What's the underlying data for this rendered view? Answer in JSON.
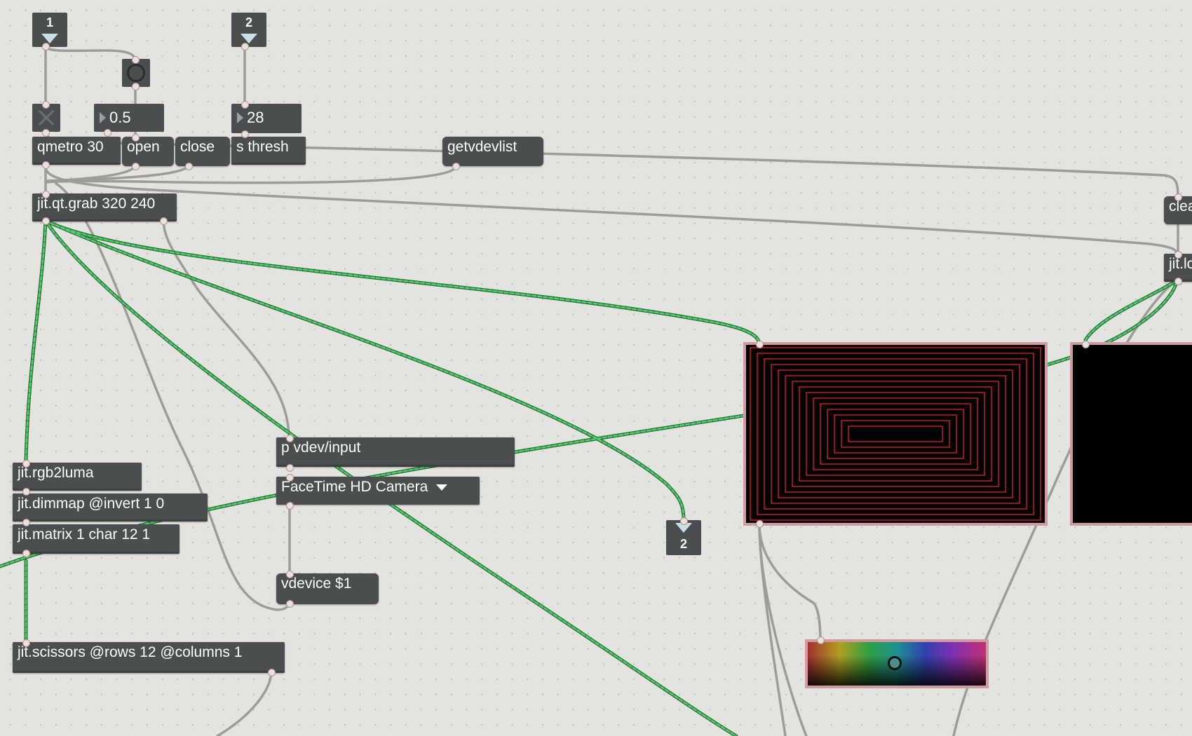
{
  "patcher": {
    "flags": [
      {
        "id": "flag-1",
        "label": "1"
      },
      {
        "id": "flag-2",
        "label": "2"
      },
      {
        "id": "flag-out-2",
        "label": "2"
      }
    ],
    "numbers": {
      "float_value": "0.5",
      "int_value": "28"
    },
    "objects": {
      "qmetro": "qmetro 30",
      "open": "open",
      "close": "close",
      "s_thresh": "s thresh",
      "getvdevlist": "getvdevlist",
      "clear": "clear",
      "grab": "jit.qt.grab 320 240",
      "jit_lcd": "jit.lcd",
      "rgb2luma": "jit.rgb2luma",
      "dimmap": "jit.dimmap @invert 1 0",
      "matrix": "jit.matrix 1 char 12 1",
      "scissors": "jit.scissors @rows 12 @columns 1",
      "p_vdev": "p vdev/input",
      "vdevice": "vdevice $1"
    },
    "umenu": {
      "selected": "FaceTime HD Camera"
    }
  },
  "colors": {
    "background": "#e3e3df",
    "object_fill": "#4b4e4f",
    "patchcord_gray": "#9c9d99",
    "patchcord_matrix": "#4fd06a",
    "display_border": "#d09aa1",
    "display_lines": "#d42020"
  }
}
